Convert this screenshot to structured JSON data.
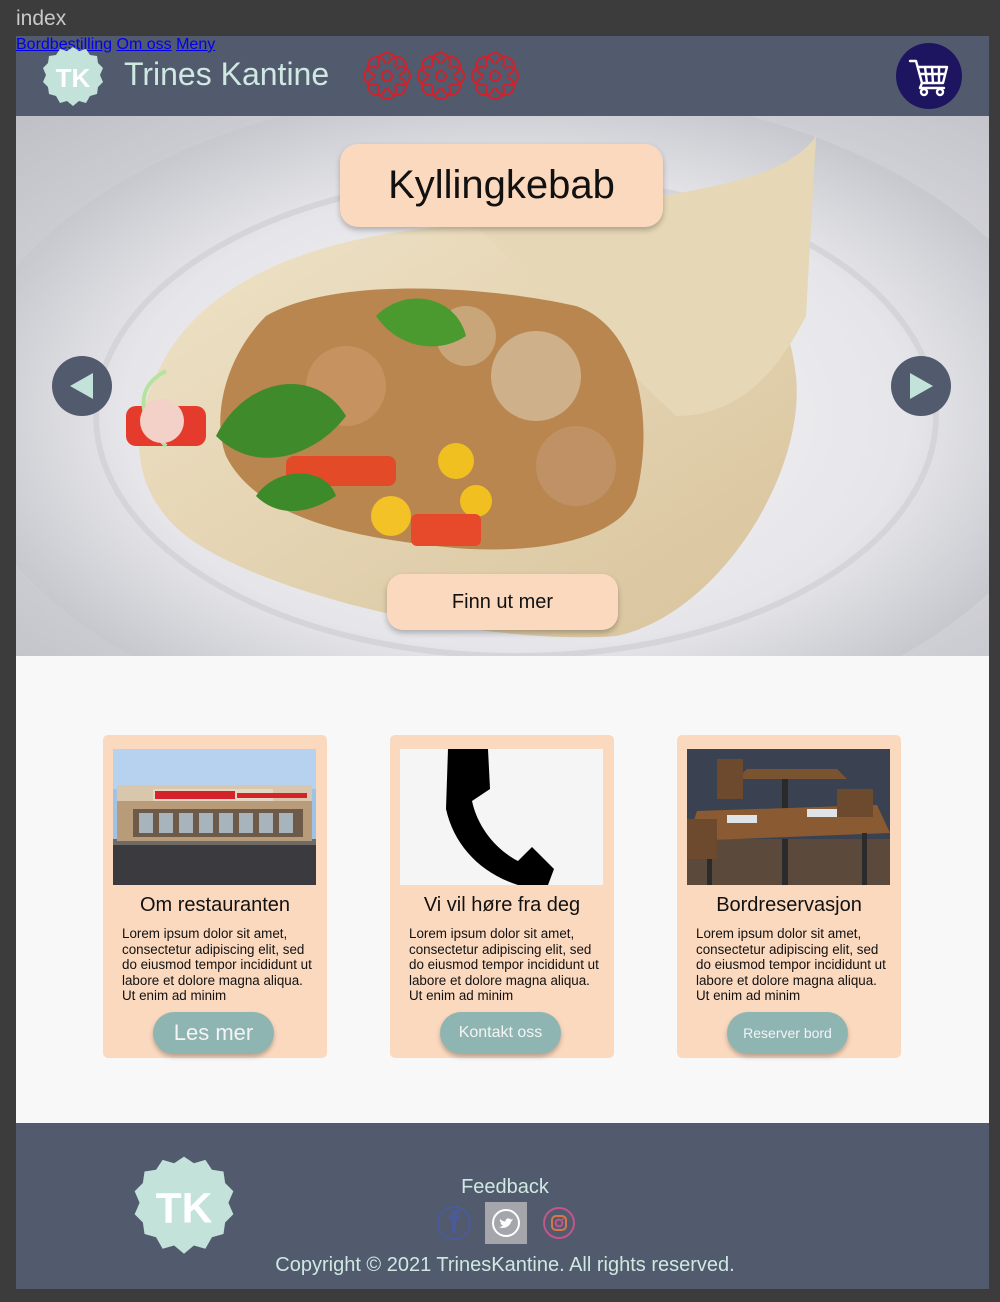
{
  "window": {
    "label": "index"
  },
  "header": {
    "logo_text": "TK",
    "brand": "Trines Kantine",
    "stars_count": 3,
    "star_color": "#d0222c",
    "nav": [
      {
        "label": "Bordbestilling"
      },
      {
        "label": "Om oss"
      },
      {
        "label": "Meny"
      }
    ],
    "cart_icon": "shopping-cart-icon"
  },
  "hero": {
    "title": "Kyllingkebab",
    "cta": "Finn ut mer",
    "prev_icon": "triangle-left-icon",
    "next_icon": "triangle-right-icon"
  },
  "cards": [
    {
      "title": "Om restauranten",
      "text": "Lorem ipsum dolor sit amet, consectetur adipiscing elit, sed do eiusmod tempor incididunt ut labore et dolore magna aliqua. Ut enim ad minim",
      "button": "Les mer",
      "image": "restaurant-storefront"
    },
    {
      "title": "Vi vil høre fra deg",
      "text": "Lorem ipsum dolor sit amet, consectetur adipiscing elit, sed do eiusmod tempor incididunt ut labore et dolore magna aliqua. Ut enim ad minim",
      "button": "Kontakt oss",
      "image": "phone-icon"
    },
    {
      "title": "Bordreservasjon",
      "text": "Lorem ipsum dolor sit amet, consectetur adipiscing elit, sed do eiusmod tempor incididunt ut labore et dolore magna aliqua. Ut enim ad minim",
      "button": "Reserver bord",
      "image": "dining-tables"
    }
  ],
  "footer": {
    "logo_text": "TK",
    "feedback": "Feedback",
    "social": [
      "facebook-icon",
      "twitter-icon",
      "instagram-icon"
    ],
    "copyright": "Copyright © 2021 TrinesKantine. All rights reserved."
  },
  "colors": {
    "header_bg": "#525a6d",
    "accent_text": "#cfe9e2",
    "card_bg": "#fbd9bf",
    "button_teal": "#8fb5b2",
    "cart_bg": "#1d1560"
  }
}
